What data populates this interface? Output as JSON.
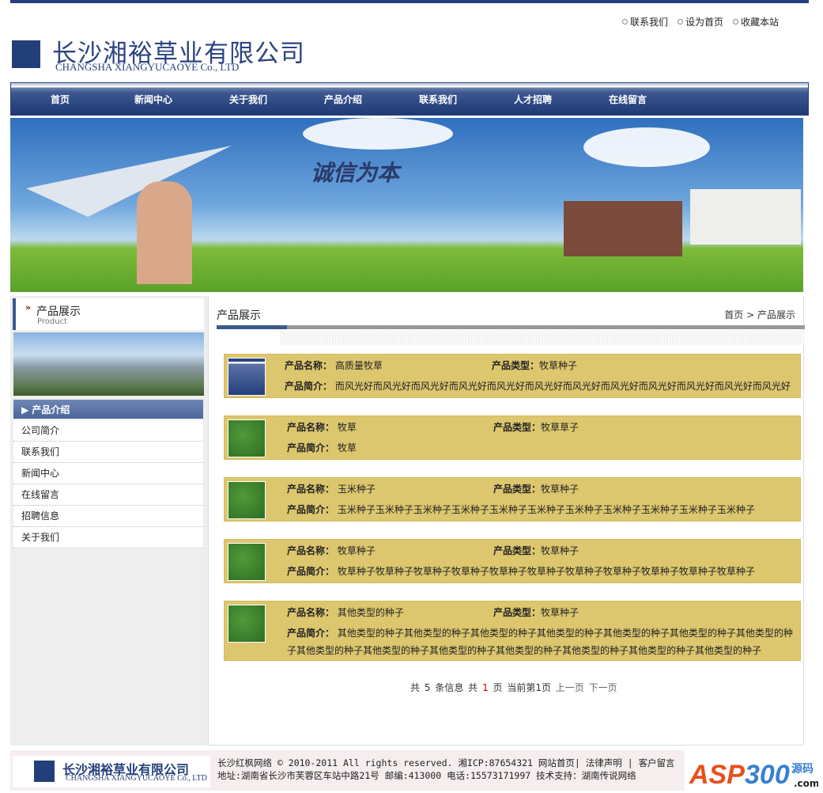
{
  "top_links": [
    "联系我们",
    "设为首页",
    "收藏本站"
  ],
  "company": {
    "name_cn": "长沙湘裕草业有限公司",
    "name_en": "CHANGSHA XIANGYUCAOYE  Co., LTD"
  },
  "nav": [
    "首页",
    "新闻中心",
    "关于我们",
    "产品介绍",
    "联系我们",
    "人才招聘",
    "在线留言"
  ],
  "banner": {
    "slogan": "诚信为本"
  },
  "sidebar": {
    "title": "产品展示",
    "subtitle": "Product",
    "category": "产品介绍",
    "items": [
      "公司简介",
      "联系我们",
      "新闻中心",
      "在线留言",
      "招聘信息",
      "关于我们"
    ]
  },
  "main": {
    "title": "产品展示",
    "breadcrumb": {
      "home": "首页",
      "sep": ">",
      "current": "产品展示"
    },
    "labels": {
      "name": "产品名称：",
      "type": "产品类型：",
      "intro": "产品简介："
    },
    "products": [
      {
        "name": "高质量牧草",
        "type": "牧草种子",
        "intro": "而风光好而风光好而风光好而风光好而风光好而风光好而风光好而风光好而风光好而风光好而风光好而风光好"
      },
      {
        "name": "牧草",
        "type": "牧草草子",
        "intro": "牧草"
      },
      {
        "name": "玉米种子",
        "type": "牧草种子",
        "intro": "玉米种子玉米种子玉米种子玉米种子玉米种子玉米种子玉米种子玉米种子玉米种子玉米种子玉米种子"
      },
      {
        "name": "牧草种子",
        "type": "牧草种子",
        "intro": "牧草种子牧草种子牧草种子牧草种子牧草种子牧草种子牧草种子牧草种子牧草种子牧草种子牧草种子"
      },
      {
        "name": "其他类型的种子",
        "type": "牧草种子",
        "intro": "其他类型的种子其他类型的种子其他类型的种子其他类型的种子其他类型的种子其他类型的种子其他类型的种子其他类型的种子其他类型的种子其他类型的种子其他类型的种子其他类型的种子其他类型的种子其他类型的种子"
      }
    ],
    "pager": {
      "total_prefix": "共",
      "total": "5",
      "total_suffix": "条信息",
      "pages_prefix": "共",
      "pages": "1",
      "pages_suffix": "页",
      "current": "当前第1页",
      "prev": "上一页",
      "next": "下一页"
    }
  },
  "footer": {
    "name_cn": "长沙湘裕草业有限公司",
    "name_en": "CHANGSHA XIANGYUCAOYE Co., LTD",
    "line1": "长沙红枫网络 © 2010-2011 All rights reserved. 湘ICP:87654321",
    "links": [
      "网站首页",
      "法律声明",
      "客户留言"
    ],
    "line2": "地址:湖南省长沙市芙蓉区车站中路21号 邮编:413000 电话:15573171997 技术支持：湖南传说网络",
    "badge": "ASP300源码 .com"
  },
  "colors": {
    "brand": "#233f7a",
    "product_bg": "#dcc66e",
    "accent_red": "#c00000"
  }
}
